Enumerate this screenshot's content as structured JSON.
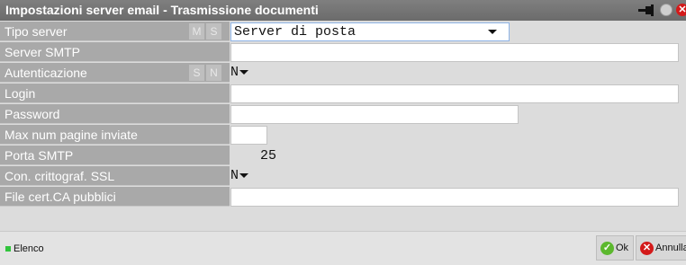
{
  "window": {
    "title": "Impostazioni server email - Trasmissione documenti",
    "close_glyph": "✕"
  },
  "fields": [
    {
      "label": "Tipo server",
      "tags": [
        "M",
        "S"
      ],
      "value": "Server di posta",
      "type": "dropdown"
    },
    {
      "label": "Server SMTP",
      "value": "",
      "type": "text"
    },
    {
      "label": "Autenticazione",
      "tags": [
        "S",
        "N"
      ],
      "value": "N",
      "type": "combo"
    },
    {
      "label": "Login",
      "value": "",
      "type": "text"
    },
    {
      "label": "Password",
      "value": "",
      "type": "text"
    },
    {
      "label": "Max num pagine inviate",
      "value": "",
      "type": "text"
    },
    {
      "label": "Porta SMTP",
      "value": "25",
      "type": "text"
    },
    {
      "label": "Con. crittograf. SSL",
      "value": "N",
      "type": "combo"
    },
    {
      "label": "File cert.CA pubblici",
      "value": "",
      "type": "text"
    }
  ],
  "footer": {
    "elenco_label": "Elenco",
    "ok_label": "Ok",
    "ok_icon": "✓",
    "annulla_label": "Annulla",
    "annulla_icon": "✕"
  },
  "colors": {
    "titlebar": "#6f6f6f",
    "label_bg": "#a9a9a9",
    "ok_green": "#5cb82e",
    "cancel_red": "#d31a1a",
    "elenco_green": "#31c43d"
  },
  "icons": {
    "pin": "pin-icon",
    "status": "status-dot-icon",
    "close": "close-icon"
  }
}
